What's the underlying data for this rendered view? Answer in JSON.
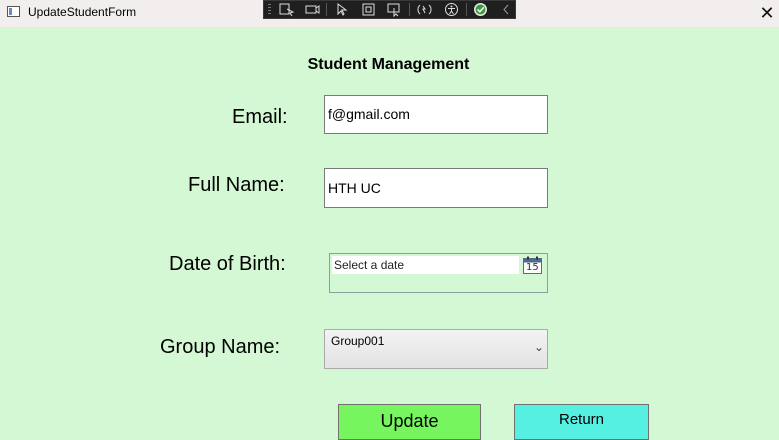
{
  "window": {
    "title": "UpdateStudentForm",
    "close_glyph": "✕"
  },
  "debug_toolbar": {
    "icons": [
      "select-element-icon",
      "display-layout-adorners-icon",
      "select-icon",
      "track-focus-icon",
      "preview-selection-icon",
      "hot-reload-icon",
      "accessibility-icon",
      "binding-failures-ok-icon",
      "collapse-chevron-icon"
    ]
  },
  "form": {
    "heading": "Student Management",
    "email": {
      "label": "Email:",
      "value": "f@gmail.com"
    },
    "full_name": {
      "label": "Full Name:",
      "value": "HTH UC"
    },
    "dob": {
      "label": "Date of Birth:",
      "placeholder": "Select a date",
      "calendar_day": "15"
    },
    "group": {
      "label": "Group Name:",
      "selected": "Group001"
    },
    "update_label": "Update",
    "return_label": "Return"
  },
  "colors": {
    "background": "#d4f7d4",
    "update_button": "#76f55e",
    "return_button": "#56f0e2"
  }
}
